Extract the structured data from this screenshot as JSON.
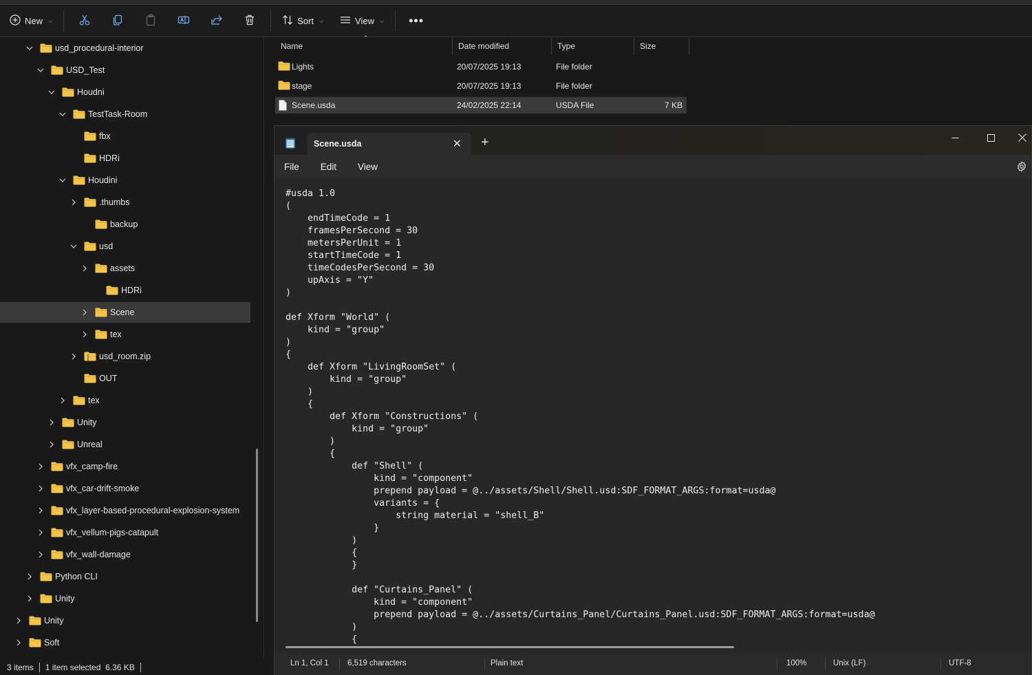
{
  "toolbar": {
    "new_label": "New",
    "sort_label": "Sort",
    "view_label": "View"
  },
  "nav_tree": [
    {
      "label": "usd_procedural-interior",
      "expanded": true
    },
    {
      "label": "USD_Test",
      "expanded": true
    },
    {
      "label": "Houdni",
      "expanded": true
    },
    {
      "label": "TestTask-Room",
      "expanded": true
    },
    {
      "label": "fbx"
    },
    {
      "label": "HDRi"
    },
    {
      "label": "Houdini",
      "expanded": true
    },
    {
      "label": ".thumbs",
      "expanded": false
    },
    {
      "label": "backup"
    },
    {
      "label": "usd",
      "expanded": true
    },
    {
      "label": "assets",
      "expanded": false
    },
    {
      "label": "HDRi"
    },
    {
      "label": "Scene",
      "expanded": false,
      "selected": true
    },
    {
      "label": "tex",
      "expanded": false
    },
    {
      "label": "usd_room.zip",
      "expanded": false,
      "zip": true
    },
    {
      "label": "OUT"
    },
    {
      "label": "tex",
      "expanded": false
    },
    {
      "label": "Unity",
      "expanded": false
    },
    {
      "label": "Unreal",
      "expanded": false
    },
    {
      "label": "vfx_camp-fire",
      "expanded": false
    },
    {
      "label": "vfx_car-drift-smoke",
      "expanded": false
    },
    {
      "label": "vfx_layer-based-procedural-explosion-system",
      "expanded": false
    },
    {
      "label": "vfx_vellum-pigs-catapult",
      "expanded": false
    },
    {
      "label": "vfx_wall-damage",
      "expanded": false
    },
    {
      "label": "Python CLI",
      "expanded": false
    },
    {
      "label": "Unity",
      "expanded": false
    },
    {
      "label": "Unity",
      "expanded": false
    },
    {
      "label": "Soft",
      "expanded": false
    }
  ],
  "file_list": {
    "columns": [
      "Name",
      "Date modified",
      "Type",
      "Size"
    ],
    "rows": [
      {
        "name": "Lights",
        "date": "20/07/2025 19:13",
        "type": "File folder",
        "size": "",
        "kind": "folder"
      },
      {
        "name": "stage",
        "date": "20/07/2025 19:13",
        "type": "File folder",
        "size": "",
        "kind": "folder"
      },
      {
        "name": "Scene.usda",
        "date": "24/02/2025 22:14",
        "type": "USDA File",
        "size": "7 KB",
        "kind": "file",
        "selected": true
      }
    ]
  },
  "explorer_status": {
    "items": "3 items",
    "selection": "1 item selected  6.36 KB"
  },
  "notepad": {
    "tab_title": "Scene.usda",
    "menu": [
      "File",
      "Edit",
      "View"
    ],
    "code": "#usda 1.0\n(\n    endTimeCode = 1\n    framesPerSecond = 30\n    metersPerUnit = 1\n    startTimeCode = 1\n    timeCodesPerSecond = 30\n    upAxis = \"Y\"\n)\n\ndef Xform \"World\" (\n    kind = \"group\"\n)\n{\n    def Xform \"LivingRoomSet\" (\n        kind = \"group\"\n    )\n    {\n        def Xform \"Constructions\" (\n            kind = \"group\"\n        )\n        {\n            def \"Shell\" (\n                kind = \"component\"\n                prepend payload = @../assets/Shell/Shell.usd:SDF_FORMAT_ARGS:format=usda@\n                variants = {\n                    string material = \"shell_B\"\n                }\n            )\n            {\n            }\n\n            def \"Curtains_Panel\" (\n                kind = \"component\"\n                prepend payload = @../assets/Curtains_Panel/Curtains_Panel.usd:SDF_FORMAT_ARGS:format=usda@\n            )\n            {",
    "status": {
      "position": "Ln 1, Col 1",
      "characters": "6,519 characters",
      "format": "Plain text",
      "zoom": "100%",
      "line_ending": "Unix (LF)",
      "encoding": "UTF-8"
    }
  },
  "colors": {
    "folder": "#f3c44a",
    "selection": "#3a3a3a",
    "background": "#191919"
  }
}
